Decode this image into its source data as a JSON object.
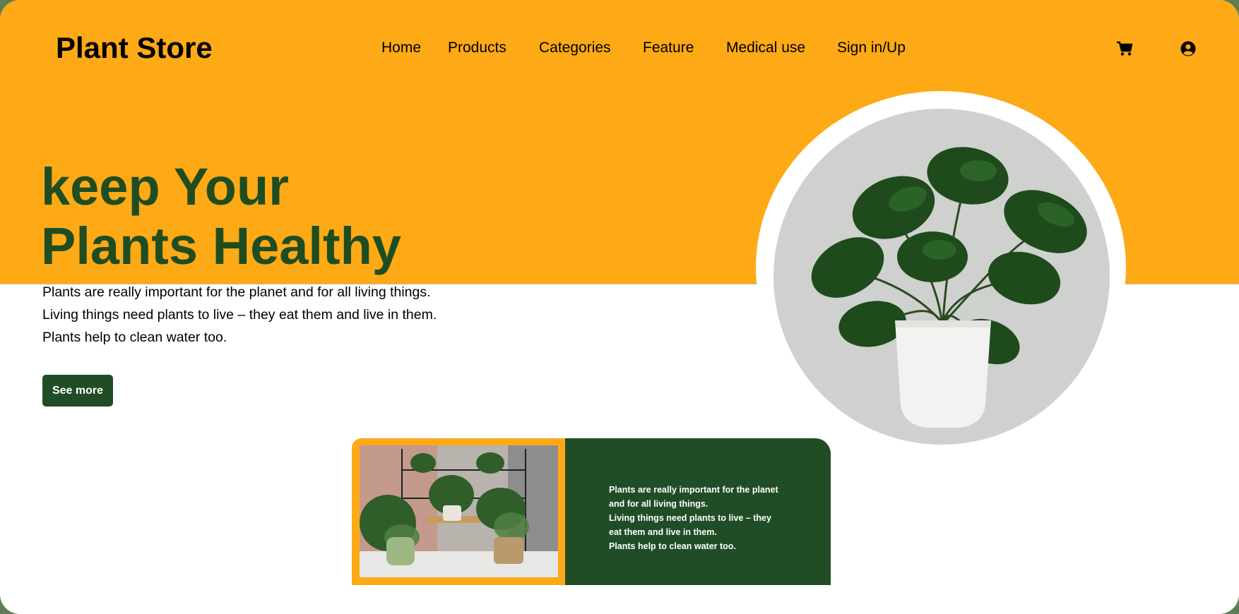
{
  "header": {
    "brand": "Plant Store",
    "nav": [
      {
        "id": "home",
        "label": "Home"
      },
      {
        "id": "products",
        "label": "Products"
      },
      {
        "id": "categories",
        "label": "Categories"
      },
      {
        "id": "feature",
        "label": "Feature"
      },
      {
        "id": "medical",
        "label": "Medical use"
      },
      {
        "id": "signin",
        "label": "Sign in/Up"
      }
    ],
    "icons": [
      "cart-icon",
      "user-account-icon"
    ]
  },
  "hero": {
    "headline_line1": "keep Your",
    "headline_line2": "Plants Healthy",
    "intro_lines": [
      "Plants are really important for the planet and for all living things.",
      "Living things need plants to live – they eat them and live in them.",
      "Plants help to clean water too."
    ],
    "cta_label": "See more",
    "image": "monstera-plant-in-white-pot"
  },
  "feature_card": {
    "image": "indoor-plants-on-shelf",
    "text_lines": [
      "Plants are really important for the planet",
      "and for all living things.",
      "Living things need plants to live – they",
      "eat them and live in them.",
      "Plants help to clean water too."
    ]
  },
  "colors": {
    "accent_orange": "#fea916",
    "brand_green": "#214d26",
    "headline_green": "#1f4d22"
  }
}
